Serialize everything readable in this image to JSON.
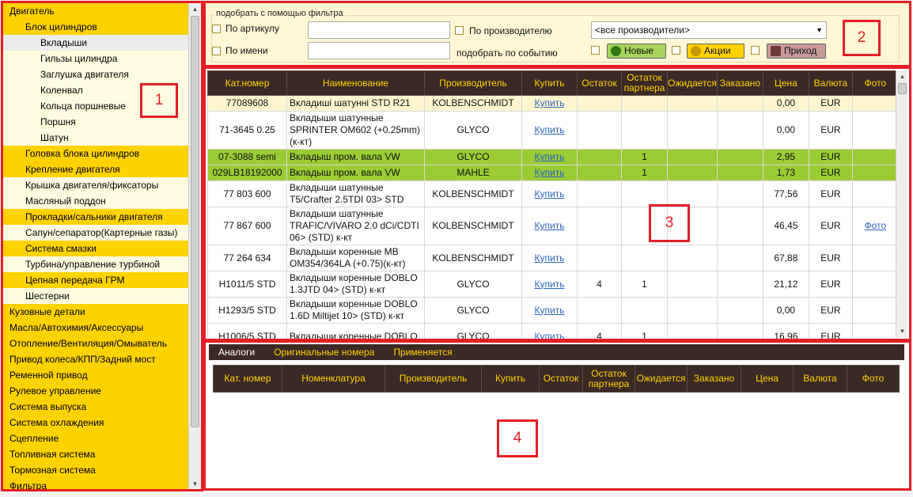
{
  "sidebar": {
    "items": [
      {
        "label": "Двигатель",
        "level": 0,
        "style": "y"
      },
      {
        "label": "Блок цилиндров",
        "level": 1,
        "style": "y"
      },
      {
        "label": "Вкладыши",
        "level": 2,
        "style": "g"
      },
      {
        "label": "Гильзы цилиндра",
        "level": 2,
        "style": "w"
      },
      {
        "label": "Заглушка двигателя",
        "level": 2,
        "style": "w"
      },
      {
        "label": "Коленвал",
        "level": 2,
        "style": "w"
      },
      {
        "label": "Кольца поршневые",
        "level": 2,
        "style": "w"
      },
      {
        "label": "Поршня",
        "level": 2,
        "style": "w"
      },
      {
        "label": "Шатун",
        "level": 2,
        "style": "w"
      },
      {
        "label": "Головка блока цилиндров",
        "level": 1,
        "style": "y"
      },
      {
        "label": "Крепление двигателя",
        "level": 1,
        "style": "y"
      },
      {
        "label": "Крышка двигателя/фиксаторы",
        "level": 1,
        "style": "w"
      },
      {
        "label": "Масляный поддон",
        "level": 1,
        "style": "w"
      },
      {
        "label": "Прокладки/сальники двигателя",
        "level": 1,
        "style": "y"
      },
      {
        "label": "Сапун/сепаратор(Картерные газы)",
        "level": 1,
        "style": "w"
      },
      {
        "label": "Система смазки",
        "level": 1,
        "style": "y"
      },
      {
        "label": "Турбина/управление турбиной",
        "level": 1,
        "style": "w"
      },
      {
        "label": "Цепная передача ГРМ",
        "level": 1,
        "style": "y"
      },
      {
        "label": "Шестерни",
        "level": 1,
        "style": "w"
      },
      {
        "label": "Кузовные детали",
        "level": 0,
        "style": "y"
      },
      {
        "label": "Масла/Автохимия/Аксессуары",
        "level": 0,
        "style": "y"
      },
      {
        "label": "Отопление/Вентиляция/Омыватель",
        "level": 0,
        "style": "y"
      },
      {
        "label": "Привод колеса/КПП/Задний мост",
        "level": 0,
        "style": "y"
      },
      {
        "label": "Ременной привод",
        "level": 0,
        "style": "y"
      },
      {
        "label": "Рулевое управление",
        "level": 0,
        "style": "y"
      },
      {
        "label": "Система выпуска",
        "level": 0,
        "style": "y"
      },
      {
        "label": "Система охлаждения",
        "level": 0,
        "style": "y"
      },
      {
        "label": "Сцепление",
        "level": 0,
        "style": "y"
      },
      {
        "label": "Топливная система",
        "level": 0,
        "style": "y"
      },
      {
        "label": "Тормозная система",
        "level": 0,
        "style": "y"
      },
      {
        "label": "Фильтра",
        "level": 0,
        "style": "y"
      }
    ]
  },
  "filter": {
    "legend": "подобрать с помощью фильтра",
    "by_article": "По артикулу",
    "by_name": "По имени",
    "by_manufacturer": "По производителю",
    "by_event": "подобрать по событию",
    "manufacturer_select": "<все производители>",
    "btn_new": "Новые",
    "btn_promo": "Акции",
    "btn_arrival": "Приход"
  },
  "main_table": {
    "columns": [
      "Кат.номер",
      "Наименование",
      "Производитель",
      "Купить",
      "Остаток",
      "Остаток партнера",
      "Ожидается",
      "Заказано",
      "Цена",
      "Валюта",
      "Фото"
    ],
    "rows": [
      {
        "cat": "77089608",
        "name": "Вкладиші шатунні STD R21",
        "mfr": "KOLBENSCHMIDT",
        "buy": "Купить",
        "stock": "",
        "pstock": "",
        "exp": "",
        "ord": "",
        "price": "0,00",
        "cur": "EUR",
        "photo": "",
        "style": "sel"
      },
      {
        "cat": "71-3645 0.25",
        "name": "Вкладыши шатунные SPRINTER OM602 (+0.25mm)(к-кт)",
        "mfr": "GLYCO",
        "buy": "Купить",
        "stock": "",
        "pstock": "",
        "exp": "",
        "ord": "",
        "price": "0,00",
        "cur": "EUR",
        "photo": "",
        "style": ""
      },
      {
        "cat": "07-3088 semi",
        "name": "Вкладыш пром. вала VW",
        "mfr": "GLYCO",
        "buy": "Купить",
        "stock": "",
        "pstock": "1",
        "exp": "",
        "ord": "",
        "price": "2,95",
        "cur": "EUR",
        "photo": "",
        "style": "gr"
      },
      {
        "cat": "029LB18192000",
        "name": "Вкладыш пром. вала VW",
        "mfr": "MAHLE",
        "buy": "Купить",
        "stock": "",
        "pstock": "1",
        "exp": "",
        "ord": "",
        "price": "1,73",
        "cur": "EUR",
        "photo": "",
        "style": "gr"
      },
      {
        "cat": "77 803 600",
        "name": "Вкладыши шатунные T5/Crafter 2.5TDI 03> STD",
        "mfr": "KOLBENSCHMIDT",
        "buy": "Купить",
        "stock": "",
        "pstock": "",
        "exp": "",
        "ord": "",
        "price": "77,56",
        "cur": "EUR",
        "photo": "",
        "style": ""
      },
      {
        "cat": "77 867 600",
        "name": "Вкладыши шатунные TRAFIC/VIVARO 2.0 dCi/CDTI 06> (STD) к-кт",
        "mfr": "KOLBENSCHMIDT",
        "buy": "Купить",
        "stock": "",
        "pstock": "",
        "exp": "",
        "ord": "",
        "price": "46,45",
        "cur": "EUR",
        "photo": "Фото",
        "style": ""
      },
      {
        "cat": "77 264 634",
        "name": "Вкладыши коренные MB OM354/364LA (+0.75)(к-кт)",
        "mfr": "KOLBENSCHMIDT",
        "buy": "Купить",
        "stock": "",
        "pstock": "",
        "exp": "",
        "ord": "",
        "price": "67,88",
        "cur": "EUR",
        "photo": "",
        "style": ""
      },
      {
        "cat": "H1011/5 STD",
        "name": "Вкладыши коренные DOBLO 1.3JTD 04> (STD) к-кт",
        "mfr": "GLYCO",
        "buy": "Купить",
        "stock": "4",
        "pstock": "1",
        "exp": "",
        "ord": "",
        "price": "21,12",
        "cur": "EUR",
        "photo": "",
        "style": ""
      },
      {
        "cat": "H1293/5 STD",
        "name": "Вкладыши коренные DOBLO 1.6D Miltijet 10> (STD) к-кт",
        "mfr": "GLYCO",
        "buy": "Купить",
        "stock": "",
        "pstock": "",
        "exp": "",
        "ord": "",
        "price": "0,00",
        "cur": "EUR",
        "photo": "",
        "style": ""
      },
      {
        "cat": "H1006/5 STD",
        "name": "Вкладыши коренные DOBLO",
        "mfr": "GLYCO",
        "buy": "Купить",
        "stock": "4",
        "pstock": "1",
        "exp": "",
        "ord": "",
        "price": "16,96",
        "cur": "EUR",
        "photo": "",
        "style": ""
      }
    ]
  },
  "bottom": {
    "tabs": [
      "Аналоги",
      "Оригинальные номера",
      "Применяется"
    ],
    "columns": [
      "Кат. номер",
      "Номенклатура",
      "Производитель",
      "Купить",
      "Остаток",
      "Остаток партнера",
      "Ожидается",
      "Заказано",
      "Цена",
      "Валюта",
      "Фото"
    ]
  },
  "annotations": {
    "n1": "1",
    "n2": "2",
    "n3": "3",
    "n4": "4"
  }
}
